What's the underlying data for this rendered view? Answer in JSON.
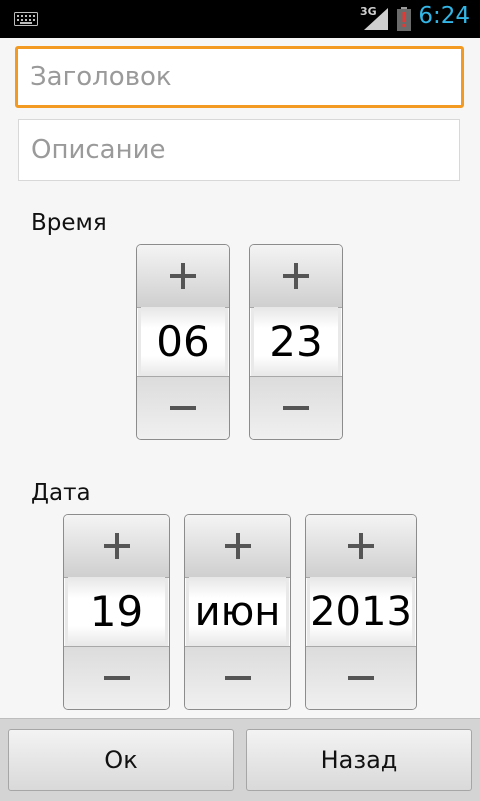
{
  "status_bar": {
    "network": "3G",
    "time": "6:24",
    "icons": [
      "keyboard-icon",
      "signal-icon",
      "battery-alert-icon"
    ]
  },
  "form": {
    "title_placeholder": "Заголовок",
    "description_placeholder": "Описание"
  },
  "time_section": {
    "label": "Время",
    "hour": "06",
    "minute": "23"
  },
  "date_section": {
    "label": "Дата",
    "day": "19",
    "month": "июн",
    "year": "2013"
  },
  "picker_icons": {
    "increment": "plus-icon",
    "decrement": "minus-icon"
  },
  "buttons": {
    "ok": "Ок",
    "back": "Назад"
  },
  "colors": {
    "accent_focus": "#f39a23",
    "clock": "#33b5e5",
    "battery_alert": "#e53935"
  }
}
